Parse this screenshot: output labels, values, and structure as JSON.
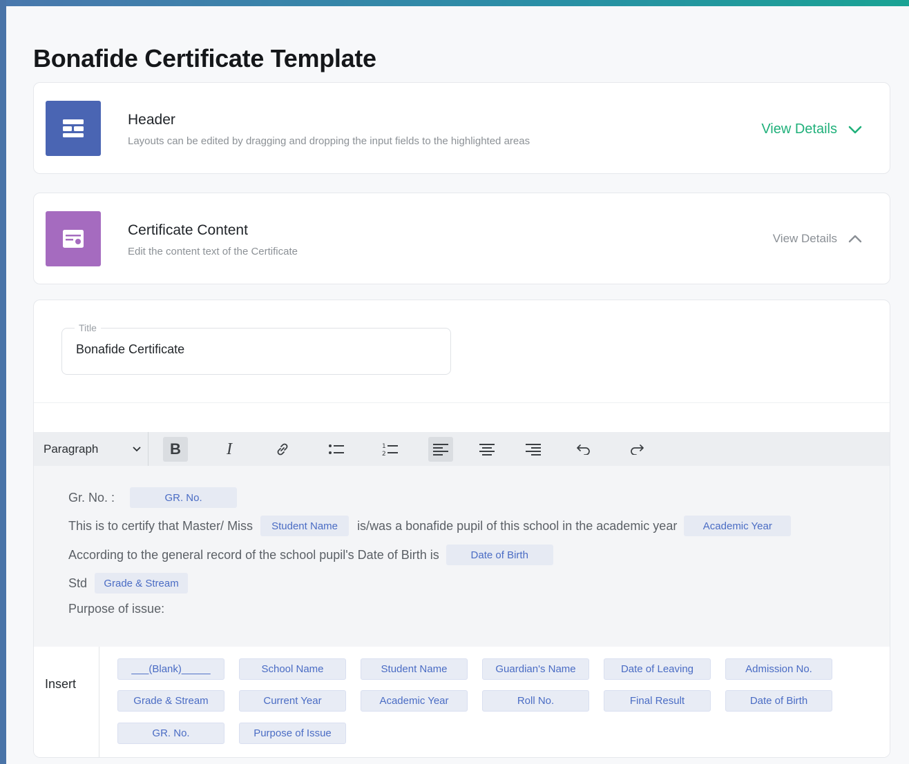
{
  "page": {
    "title": "Bonafide Certificate Template"
  },
  "colors": {
    "accent_green": "#1fb07a",
    "chip_text": "#4a6cc4",
    "header_icon_bg": "#4a65b3",
    "content_icon_bg": "#a56bbf"
  },
  "sections": {
    "header": {
      "icon": "layout-icon",
      "title": "Header",
      "subtitle": "Layouts can be edited by dragging and dropping the input fields to the highlighted areas",
      "view_details": "View Details",
      "expanded": false
    },
    "content": {
      "icon": "certificate-icon",
      "title": "Certificate Content",
      "subtitle": "Edit the content text of the Certificate",
      "view_details": "View Details",
      "expanded": true
    }
  },
  "title_field": {
    "label": "Title",
    "value": "Bonafide Certificate"
  },
  "toolbar": {
    "block_format": "Paragraph",
    "buttons": [
      "bold",
      "italic",
      "link",
      "bullet-list",
      "numbered-list",
      "align-left",
      "align-center",
      "align-right",
      "undo",
      "redo"
    ],
    "active": [
      "bold",
      "align-left"
    ]
  },
  "editor": {
    "line1": {
      "text": "Gr. No. :",
      "chip": "GR. No."
    },
    "line2": {
      "pre": "This is to certify that Master/ Miss",
      "chip1": "Student Name",
      "mid": "is/was a bonafide pupil of this school in the academic year",
      "chip2": "Academic Year"
    },
    "line3": {
      "pre": "According to the general record of the school pupil's Date of Birth is",
      "chip": "Date of Birth"
    },
    "line4": {
      "pre": "Std",
      "chip": "Grade & Stream"
    },
    "line5": {
      "text": "Purpose of issue:"
    }
  },
  "insert": {
    "label": "Insert",
    "chips": [
      "___(Blank)_____",
      "School Name",
      "Student Name",
      "Guardian's Name",
      "Date of Leaving",
      "Admission No.",
      "Grade & Stream",
      "Current Year",
      "Academic Year",
      "Roll No.",
      "Final Result",
      "Date of Birth",
      "GR. No.",
      "Purpose of Issue"
    ]
  }
}
